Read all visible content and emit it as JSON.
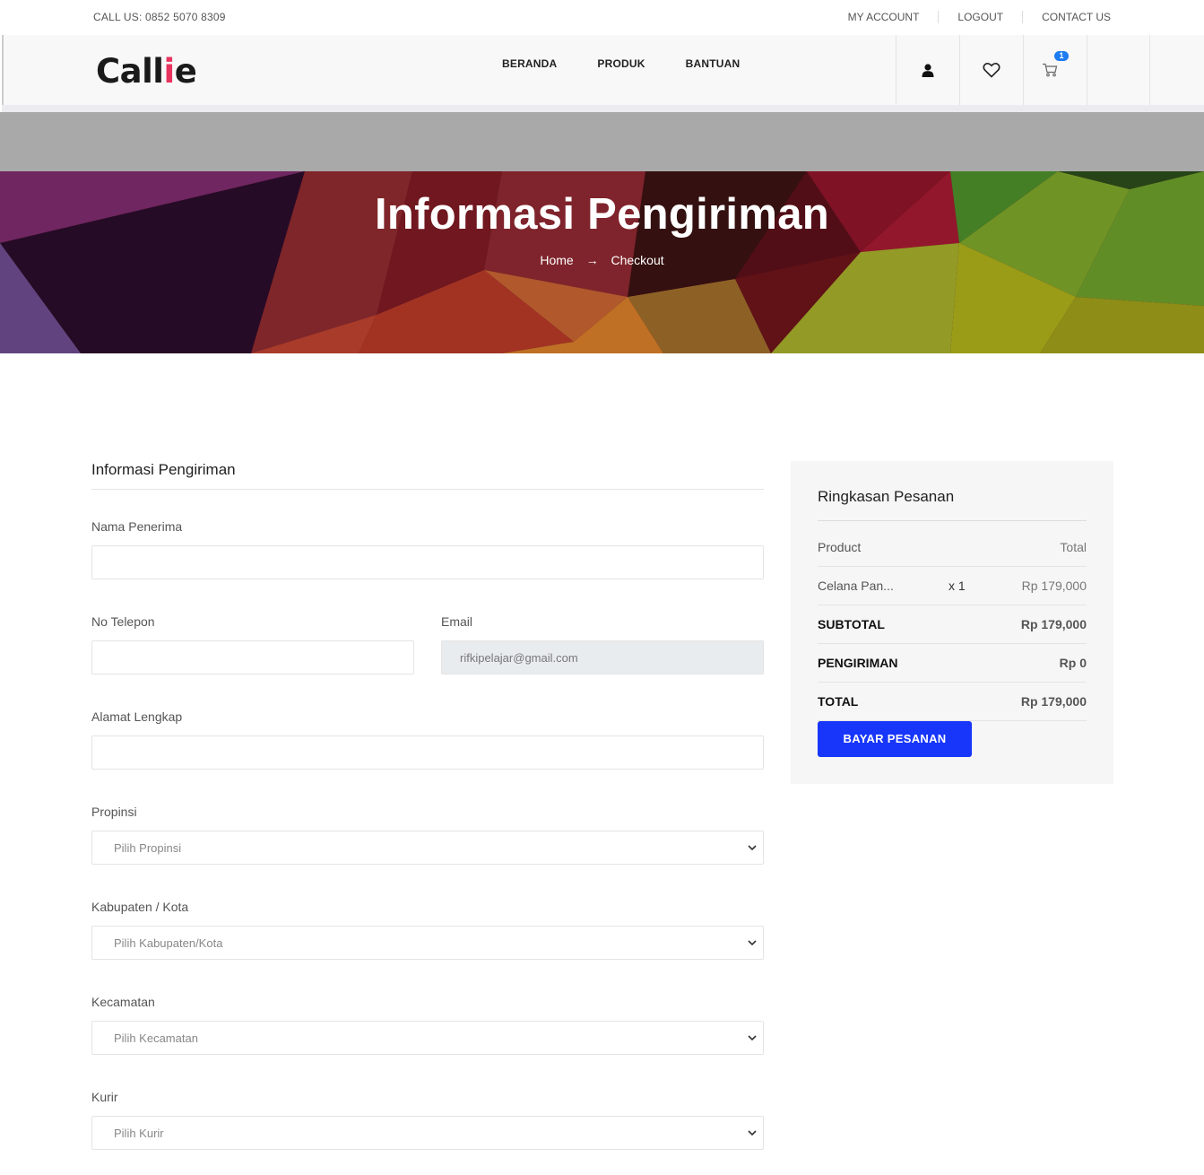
{
  "topbar": {
    "call": "CALL US: 0852 5070 8309",
    "links": [
      "MY ACCOUNT",
      "LOGOUT",
      "CONTACT US"
    ]
  },
  "header": {
    "logo_main": "Call",
    "logo_accent": "i",
    "logo_end": "e",
    "nav": [
      "BERANDA",
      "PRODUK",
      "BANTUAN"
    ],
    "cart_count": "1"
  },
  "hero": {
    "title": "Informasi Pengiriman",
    "breadcrumb": {
      "home": "Home",
      "arrow": "→",
      "current": "Checkout"
    }
  },
  "form": {
    "title": "Informasi Pengiriman",
    "nama_label": "Nama Penerima",
    "nama_value": "",
    "telepon_label": "No Telepon",
    "telepon_value": "",
    "email_label": "Email",
    "email_value": "rifkipelajar@gmail.com",
    "alamat_label": "Alamat Lengkap",
    "alamat_value": "",
    "propinsi_label": "Propinsi",
    "propinsi_value": "Pilih Propinsi",
    "kabupaten_label": "Kabupaten / Kota",
    "kabupaten_value": "Pilih Kabupaten/Kota",
    "kecamatan_label": "Kecamatan",
    "kecamatan_value": "Pilih Kecamatan",
    "kurir_label": "Kurir",
    "kurir_value": "Pilih Kurir"
  },
  "summary": {
    "title": "Ringkasan Pesanan",
    "col_product": "Product",
    "col_total": "Total",
    "item_name": "Celana Pan...",
    "item_qty": "x 1",
    "item_price": "Rp 179,000",
    "subtotal_label": "SUBTOTAL",
    "subtotal_value": "Rp 179,000",
    "shipping_label": "PENGIRIMAN",
    "shipping_value": "Rp 0",
    "total_label": "TOTAL",
    "total_value": "Rp 179,000",
    "pay_button": "BAYAR PESANAN"
  }
}
